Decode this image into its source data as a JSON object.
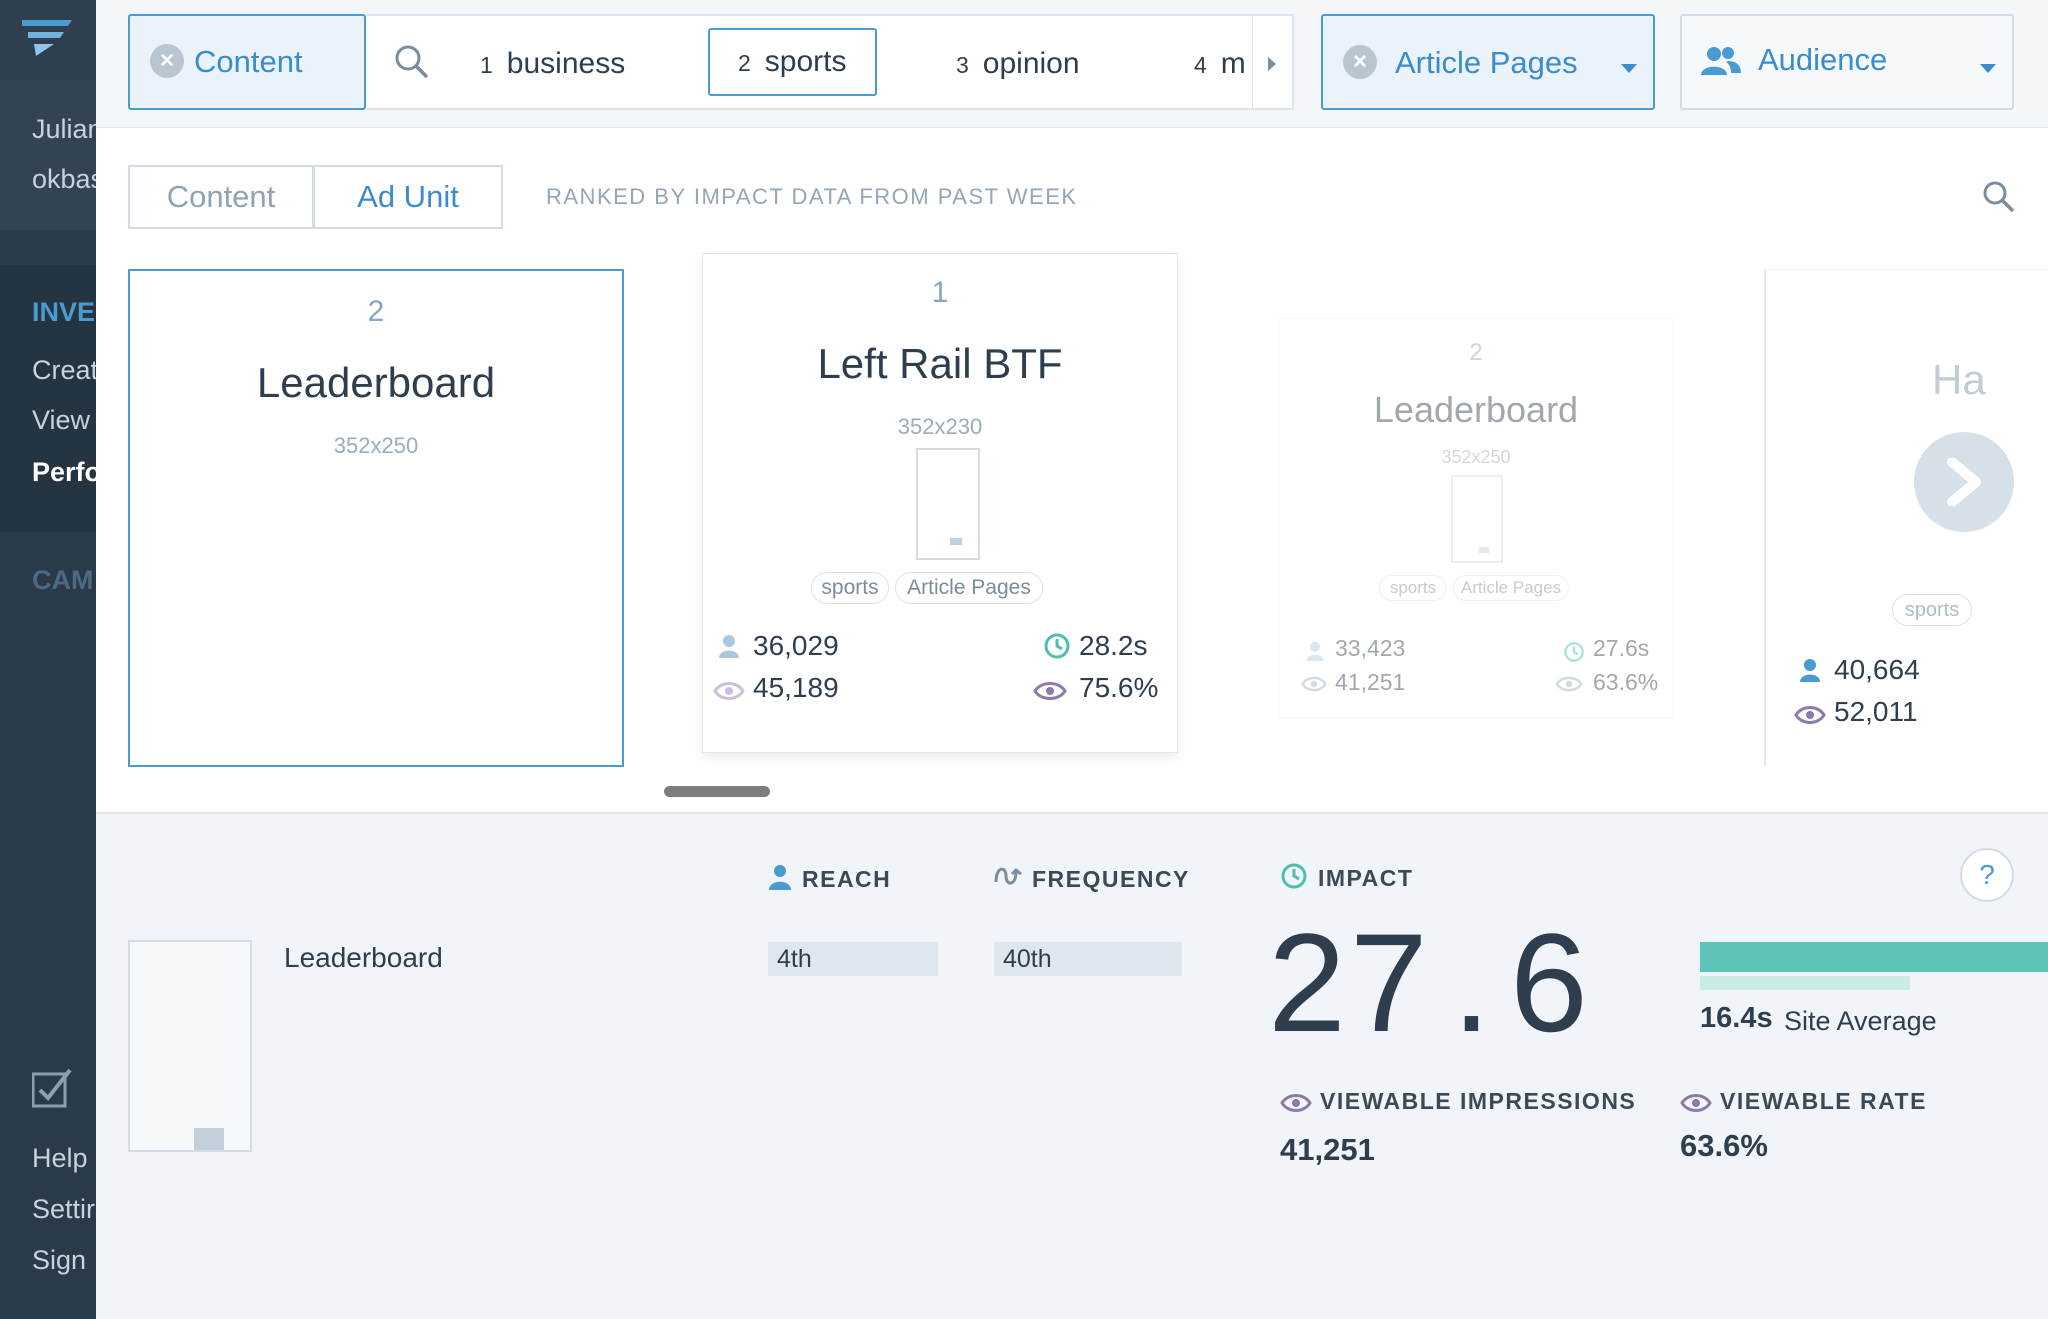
{
  "sidebar": {
    "user_line1": "Julian",
    "user_line2": "okbas",
    "section_inventory": "INVE",
    "items": [
      "Creat",
      "View",
      "Perfo"
    ],
    "section_campaigns": "CAM",
    "bottom_items": [
      "Help",
      "Settir",
      "Sign"
    ]
  },
  "filters": {
    "content": {
      "label": "Content"
    },
    "segments": [
      {
        "num": "1",
        "label": "business"
      },
      {
        "num": "2",
        "label": "sports"
      },
      {
        "num": "3",
        "label": "opinion"
      },
      {
        "num": "4",
        "label": "m"
      }
    ],
    "page_type": {
      "label": "Article Pages"
    },
    "audience": {
      "label": "Audience"
    }
  },
  "toolbar": {
    "tabs": [
      "Content",
      "Ad Unit"
    ],
    "ranked_text": "RANKED BY IMPACT DATA FROM PAST WEEK"
  },
  "cards": [
    {
      "rank": "2",
      "title": "Leaderboard",
      "size": "352x250"
    },
    {
      "rank": "1",
      "title": "Left Rail BTF",
      "size": "352x230",
      "tags": [
        "sports",
        "Article Pages"
      ],
      "reach": "36,029",
      "impressions": "45,189",
      "impact": "28.2s",
      "rate": "75.6%"
    },
    {
      "rank": "2",
      "title": "Leaderboard",
      "size": "352x250",
      "tags": [
        "sports",
        "Article Pages"
      ],
      "reach": "33,423",
      "impressions": "41,251",
      "impact": "27.6s",
      "rate": "63.6%"
    },
    {
      "title": "Ha",
      "tags": [
        "sports"
      ],
      "reach": "40,664",
      "impressions": "52,011"
    }
  ],
  "detail": {
    "name": "Leaderboard",
    "reach_label": "REACH",
    "reach_value": "4th",
    "frequency_label": "FREQUENCY",
    "frequency_value": "40th",
    "impact_label": "IMPACT",
    "impact_int": "27",
    "impact_dot": ".",
    "impact_dec": "6",
    "site_avg_value": "16.4s",
    "site_avg_label": "Site Average",
    "viewable_impressions_label": "VIEWABLE IMPRESSIONS",
    "viewable_impressions_value": "41,251",
    "viewable_rate_label": "VIEWABLE RATE",
    "viewable_rate_value": "63.6%",
    "help": "?"
  },
  "colors": {
    "accent": "#4a9bd1",
    "impact_bar": "#5ec4b8",
    "site_avg_bar": "#c8ebe6",
    "eye": "#8e79ab",
    "sidebar": "#2b3a48"
  }
}
